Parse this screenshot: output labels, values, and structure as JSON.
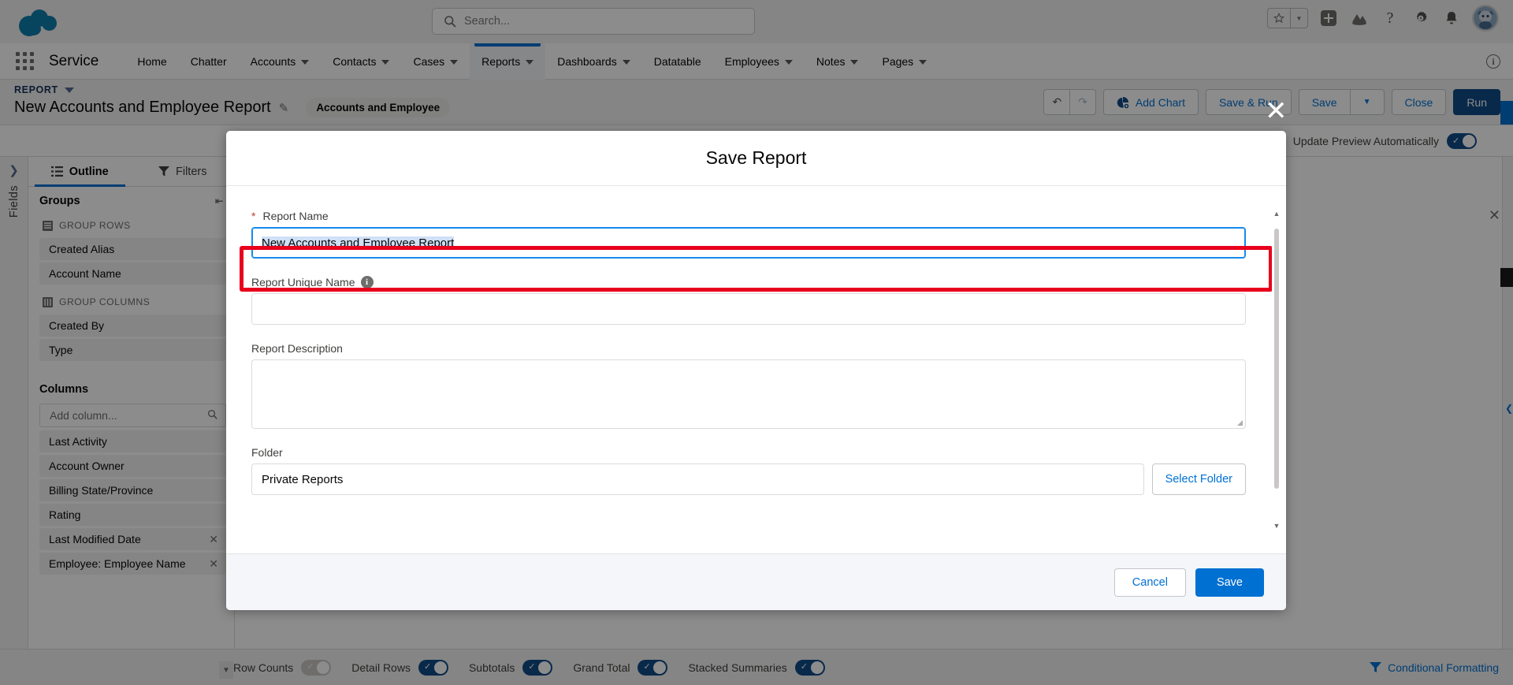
{
  "global_header": {
    "search_placeholder": "Search...",
    "icons": [
      {
        "name": "favorites-star-icon",
        "glyph": "★"
      },
      {
        "name": "favorites-dropdown-icon",
        "glyph": "▼"
      },
      {
        "name": "global-actions-icon",
        "glyph": "+"
      },
      {
        "name": "trailhead-icon",
        "glyph": "⛰"
      },
      {
        "name": "help-icon",
        "glyph": "?"
      },
      {
        "name": "setup-gear-icon",
        "glyph": "⚙"
      },
      {
        "name": "notifications-bell-icon",
        "glyph": "🔔"
      },
      {
        "name": "user-avatar",
        "glyph": ""
      }
    ]
  },
  "app_nav": {
    "app_name": "Service",
    "items": [
      {
        "label": "Home",
        "has_menu": false,
        "active": false
      },
      {
        "label": "Chatter",
        "has_menu": false,
        "active": false
      },
      {
        "label": "Accounts",
        "has_menu": true,
        "active": false
      },
      {
        "label": "Contacts",
        "has_menu": true,
        "active": false
      },
      {
        "label": "Cases",
        "has_menu": true,
        "active": false
      },
      {
        "label": "Reports",
        "has_menu": true,
        "active": true
      },
      {
        "label": "Dashboards",
        "has_menu": true,
        "active": false
      },
      {
        "label": "Datatable",
        "has_menu": false,
        "active": false
      },
      {
        "label": "Employees",
        "has_menu": true,
        "active": false
      },
      {
        "label": "Notes",
        "has_menu": true,
        "active": false
      },
      {
        "label": "Pages",
        "has_menu": true,
        "active": false
      }
    ],
    "info_glyph": "i"
  },
  "report_header": {
    "eyebrow": "REPORT",
    "title": "New Accounts and Employee Report",
    "report_type_chip": "Accounts and Employee",
    "buttons": {
      "undo": "↶",
      "redo": "↷",
      "add_chart": "Add Chart",
      "save_and_run": "Save & Run",
      "save": "Save",
      "save_dropdown": "▼",
      "close": "Close",
      "run": "Run"
    }
  },
  "sub_toolbar": {
    "update_preview_label": "Update Preview Automatically",
    "update_preview_on": true
  },
  "left_rail": {
    "collapse_glyph": "❯",
    "label": "Fields"
  },
  "outline_panel": {
    "tabs": [
      {
        "label": "Outline",
        "icon": "list-icon",
        "active": true
      },
      {
        "label": "Filters",
        "icon": "funnel-icon",
        "active": false
      }
    ],
    "groups_heading": "Groups",
    "group_rows_label": "GROUP ROWS",
    "group_rows": [
      "Created Alias",
      "Account Name"
    ],
    "group_columns_label": "GROUP COLUMNS",
    "group_columns": [
      "Created By",
      "Type"
    ],
    "columns_heading": "Columns",
    "add_column_placeholder": "Add column...",
    "columns": [
      {
        "label": "Last Activity",
        "removable": false
      },
      {
        "label": "Account Owner",
        "removable": false
      },
      {
        "label": "Billing State/Province",
        "removable": false
      },
      {
        "label": "Rating",
        "removable": false
      },
      {
        "label": "Last Modified Date",
        "removable": true
      },
      {
        "label": "Employee: Employee Name",
        "removable": true
      }
    ],
    "remove_glyph": "✕"
  },
  "bottom_bar": {
    "toggles": [
      {
        "label": "Row Counts",
        "on": false
      },
      {
        "label": "Detail Rows",
        "on": true
      },
      {
        "label": "Subtotals",
        "on": true
      },
      {
        "label": "Grand Total",
        "on": true
      },
      {
        "label": "Stacked Summaries",
        "on": true
      }
    ],
    "conditional_formatting": "Conditional Formatting",
    "conditional_formatting_icon": "format-icon"
  },
  "modal": {
    "title": "Save Report",
    "close_glyph": "✕",
    "fields": {
      "report_name": {
        "label": "Report Name",
        "required_marker": "*",
        "value": "New Accounts and Employee Report",
        "placeholder": "",
        "focused": true,
        "text_selected": true
      },
      "report_unique_name": {
        "label": "Report Unique Name",
        "info_glyph": "i",
        "value": "",
        "placeholder": ""
      },
      "report_description": {
        "label": "Report Description",
        "value": "",
        "placeholder": ""
      },
      "folder": {
        "label": "Folder",
        "value": "Private Reports",
        "select_folder_button": "Select Folder"
      }
    },
    "footer": {
      "cancel": "Cancel",
      "save": "Save"
    },
    "scroll": {
      "up_glyph": "▲",
      "down_glyph": "▼"
    }
  },
  "colors": {
    "brand_blue": "#0070d2",
    "dark_blue": "#0f4c87",
    "salesforce_cloud": "#0d7ead",
    "highlight_red": "#e8001c",
    "selection_blue": "#cfe0f7",
    "required_red": "#c23934"
  }
}
